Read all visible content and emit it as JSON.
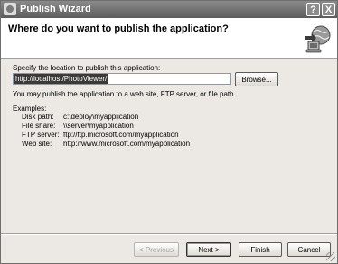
{
  "window": {
    "title": "Publish Wizard",
    "help_label": "?",
    "close_label": "X"
  },
  "header": {
    "title": "Where do you want to publish the application?",
    "icon": "globe-publish-icon"
  },
  "location": {
    "label": "Specify the location to publish this application:",
    "value": "http://localhost/PhotoViewer/",
    "browse_label": "Browse..."
  },
  "info": "You may publish the application to a web site, FTP server, or file path.",
  "examples": {
    "heading": "Examples:",
    "rows": [
      {
        "name": "Disk path:",
        "value": "c:\\deploy\\myapplication"
      },
      {
        "name": "File share:",
        "value": "\\\\server\\myapplication"
      },
      {
        "name": "FTP server:",
        "value": "ftp://ftp.microsoft.com/myapplication"
      },
      {
        "name": "Web site:",
        "value": "http://www.microsoft.com/myapplication"
      }
    ]
  },
  "footer": {
    "previous": "< Previous",
    "next": "Next >",
    "finish": "Finish",
    "cancel": "Cancel"
  }
}
